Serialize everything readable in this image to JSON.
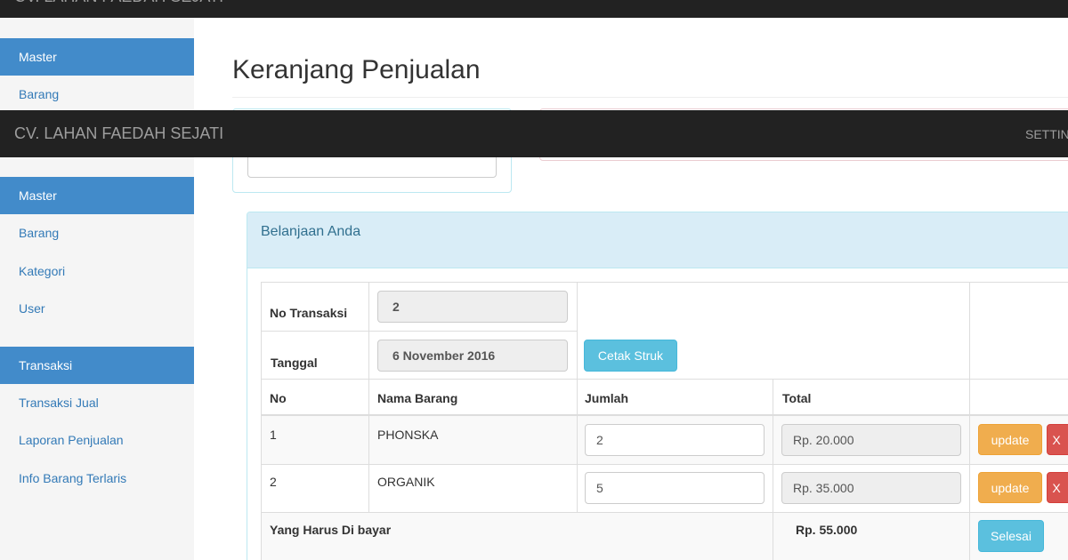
{
  "navbar": {
    "brand": "CV. LAHAN FAEDAH SEJATI",
    "right_link": "SETTIN"
  },
  "sidebar": {
    "top_section": {
      "header": "Master",
      "items": [
        "Barang"
      ]
    },
    "master": {
      "header": "Master",
      "items": [
        "Barang",
        "Kategori",
        "User"
      ]
    },
    "transaksi": {
      "header": "Transaksi",
      "items": [
        "Transaksi Jual",
        "Laporan Penjualan",
        "Info Barang Terlaris"
      ]
    }
  },
  "page": {
    "title": "Keranjang Penjualan"
  },
  "cart": {
    "heading": "Belanjaan Anda",
    "no_transaksi_label": "No Transaksi",
    "no_transaksi_value": "2",
    "tanggal_label": "Tanggal",
    "tanggal_value": "6 November 2016",
    "cetak_button": "Cetak Struk",
    "columns": [
      "No",
      "Nama Barang",
      "Jumlah",
      "Total"
    ],
    "rows": [
      {
        "no": "1",
        "nama": "PHONSKA",
        "jumlah": "2",
        "total": "Rp. 20.000",
        "update": "update",
        "delete": "X"
      },
      {
        "no": "2",
        "nama": "ORGANIK",
        "jumlah": "5",
        "total": "Rp. 35.000",
        "update": "update",
        "delete": "X"
      }
    ],
    "total_label": "Yang Harus Di bayar",
    "total_value": "Rp. 55.000",
    "selesai_button": "Selesai"
  },
  "colors": {
    "navbar_bg": "#222222",
    "sidebar_header": "#428bca",
    "link": "#337ab7",
    "info": "#5bc0de",
    "warning": "#f0ad4e",
    "danger": "#d9534f"
  }
}
